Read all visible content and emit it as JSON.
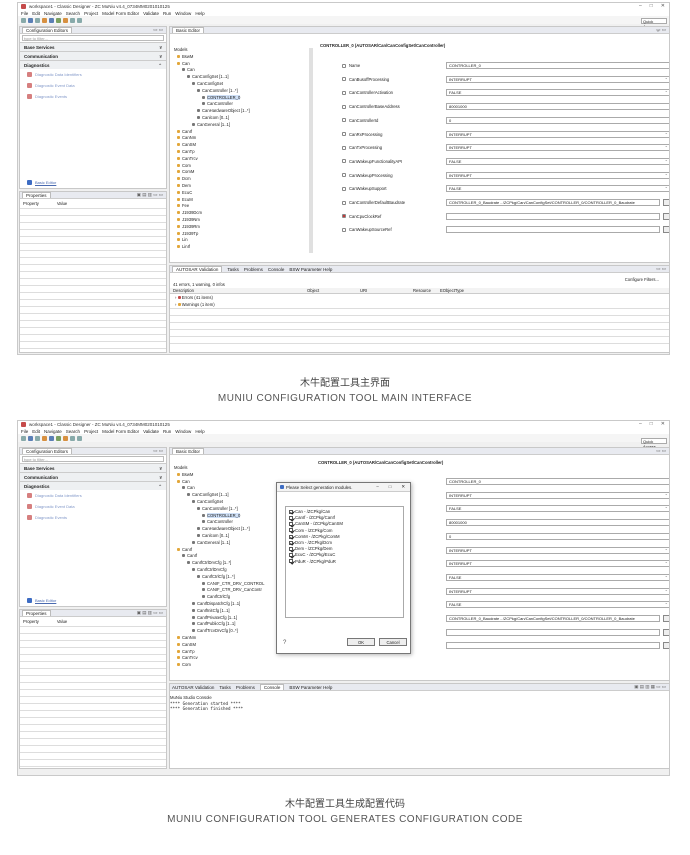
{
  "window": {
    "title": "workspace1 - Classic Designer - ZC MuNiu v4.4_0734MM0201010125",
    "minimize": "–",
    "maximize": "□",
    "close": "✕",
    "quick_access": "Quick Access"
  },
  "menu": [
    "File",
    "Edit",
    "Navigate",
    "Search",
    "Project",
    "Model Form Editor",
    "Validate",
    "Run",
    "Window",
    "Help"
  ],
  "config_editors": {
    "tab": "Configuration Editors",
    "filter_placeholder": "type to filter...",
    "sections": [
      "Base Services",
      "Communication",
      "Diagnostics"
    ],
    "diag_items": [
      "Diagnostic Data Identifiers",
      "Diagnostic Event Data",
      "Diagnostic Events"
    ],
    "basic_editor_link": "Basic Editor"
  },
  "properties": {
    "tab": "Properties",
    "col_property": "Property",
    "col_value": "Value"
  },
  "basic_editor": {
    "tab": "Basic Editor",
    "models_label": "Models"
  },
  "tree1": [
    "BswM",
    "Can",
    "Can",
    "CanConfigSet [1..1]",
    "CanConfigSet",
    "CanController [1..*]",
    "CONTROLLER_0",
    "CanController",
    "CanHardwareObject [1..*]",
    "Canlcom [0..1]",
    "CanGeneral [1..1]",
    "CanIf",
    "CanNm",
    "CanSM",
    "CanTp",
    "CanTrcv",
    "Com",
    "ComM",
    "Dcm",
    "Dem",
    "EcuC",
    "EcuM",
    "Fee",
    "J1939Dcm",
    "J1939Nm",
    "J1939Rm",
    "J1939Tp",
    "Lin",
    "LinIf"
  ],
  "form": {
    "title": "CONTROLLER_0 (AUTOSAR/Can/CanConfigSet/CanController)",
    "fields": [
      {
        "label": "Name",
        "value": "CONTROLLER_0",
        "dd": false
      },
      {
        "label": "CanBusoffProcessing",
        "value": "INTERRUPT",
        "dd": true
      },
      {
        "label": "CanControllerActivation",
        "value": "FALSE",
        "dd": true
      },
      {
        "label": "CanControllerBaseAddress",
        "value": "80001000",
        "dd": false
      },
      {
        "label": "CanControllerId",
        "value": "0",
        "dd": false
      },
      {
        "label": "CanRxProcessing",
        "value": "INTERRUPT",
        "dd": true
      },
      {
        "label": "CanTxProcessing",
        "value": "INTERRUPT",
        "dd": true
      },
      {
        "label": "CanWakeupFunctionalityAPI",
        "value": "FALSE",
        "dd": true
      },
      {
        "label": "CanWakeupProcessing",
        "value": "INTERRUPT",
        "dd": true
      },
      {
        "label": "CanWakeupSupport",
        "value": "FALSE",
        "dd": true
      },
      {
        "label": "CanControllerDefaultBaudrate",
        "value": "CONTROLLER_0_Baudrate - /ZCPkg/Can/CanConfigSet/CONTROLLER_0/CONTROLLER_0_Baudrate",
        "dd": false
      },
      {
        "label": "CanCpuClockRef",
        "value": "",
        "dd": false
      },
      {
        "label": "CanWakeupSourceRef",
        "value": "",
        "dd": false
      }
    ]
  },
  "bottom_tabs": [
    "AUTOSAR Validation",
    "Tasks",
    "Problems",
    "Console",
    "BSW Parameter Help"
  ],
  "validation": {
    "summary": "41 errors, 1 warning, 0 infos",
    "configure": "Configure Filters...",
    "columns": [
      "Description",
      "Object",
      "URI",
      "Resource",
      "EObjectType"
    ],
    "rows": [
      "Errors (41 items)",
      "Warnings (1 item)"
    ]
  },
  "tree2": [
    "BswM",
    "Can",
    "Can",
    "CanConfigSet [1..1]",
    "CanConfigSet",
    "CanController [1..*]",
    "CONTROLLER_0",
    "CanController",
    "CanHardwareObject [1..*]",
    "Canlcom [0..1]",
    "CanGeneral [1..1]",
    "CanIf",
    "CanIf",
    "CanIfCtrlDrvCfg [1..*]",
    "CanIfCtrlDrvCfg",
    "CanIfCtrlCfg [1..*]",
    "CANIF_CTR_DRV_CONTROL",
    "CANIF_CTR_DRV_CanContr",
    "CanIfCtrlCfg",
    "CanIfDispatchCfg [1..1]",
    "CanIfInitCfg [1..1]",
    "CanIfPrivateCfg [1..1]",
    "CanIfPublicCfg [1..1]",
    "CanIfTrcvDrvCfg [0..*]",
    "CanNm",
    "CanSM",
    "CanTp",
    "CanTrcv",
    "Com"
  ],
  "dialog": {
    "title": "Please Select generation modules.",
    "items": [
      "Can - /ZCPkg/Can",
      "CanIf - /ZCPkg/CanIf",
      "CanSM - /ZCPkg/CanSM",
      "Com - /ZCPkg/Com",
      "ComM - /ZCPkg/ComM",
      "Dcm - /ZCPkg/Dcm",
      "Dem - /ZCPkg/Dem",
      "EcuC - /ZCPkg/EcuC",
      "PduR - /ZCPkg/PduR"
    ],
    "ok": "OK",
    "cancel": "Cancel",
    "help": "?"
  },
  "console": {
    "header": "MuNiu Studio Console",
    "lines": [
      "**** Generation started ****",
      "**** Generation finished ****"
    ]
  },
  "captions": {
    "c1_cn": "木牛配置工具主界面",
    "c1_en": "MUNIU CONFIGURATION TOOL MAIN INTERFACE",
    "c2_cn": "木牛配置工具生成配置代码",
    "c2_en": "MUNIU CONFIGURATION TOOL GENERATES CONFIGURATION CODE"
  }
}
